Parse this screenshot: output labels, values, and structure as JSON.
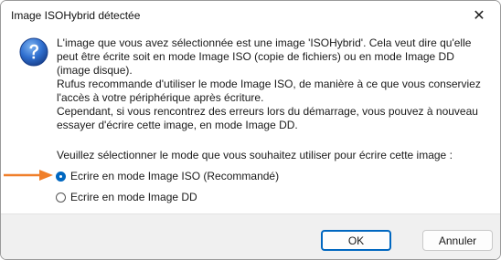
{
  "window": {
    "title": "Image ISOHybrid détectée",
    "close_glyph": "✕"
  },
  "dialog": {
    "icon": "question-icon",
    "message": [
      "L'image que vous avez sélectionnée est une image 'ISOHybrid'. Cela veut dire qu'elle peut être écrite soit en mode Image ISO (copie de fichiers) ou en mode Image DD (image disque).",
      "Rufus recommande d'utiliser le mode Image ISO, de manière à ce que vous conserviez l'accès à votre périphérique après écriture.",
      "Cependant, si vous rencontrez des erreurs lors du démarrage, vous pouvez à nouveau essayer d'écrire cette image, en mode Image DD."
    ],
    "prompt": "Veuillez sélectionner le mode que vous souhaitez utiliser pour écrire cette image :",
    "options": [
      {
        "label": "Ecrire en mode Image ISO (Recommandé)",
        "selected": true
      },
      {
        "label": "Ecrire en mode Image DD",
        "selected": false
      }
    ]
  },
  "buttons": {
    "ok": "OK",
    "cancel": "Annuler"
  },
  "colors": {
    "accent": "#0067c0",
    "arrow": "#f07f2a",
    "footer": "#f0f0f0"
  }
}
